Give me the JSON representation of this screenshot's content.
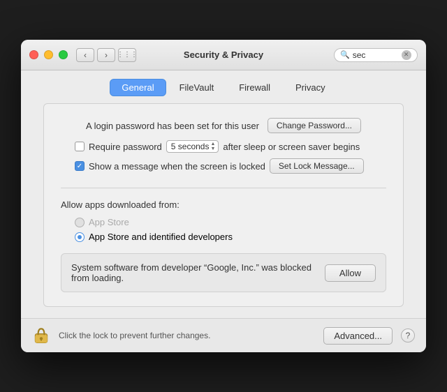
{
  "window": {
    "title": "Security & Privacy"
  },
  "titlebar": {
    "back_label": "‹",
    "forward_label": "›",
    "grid_label": "⋮⋮⋮"
  },
  "search": {
    "value": "sec",
    "placeholder": "Search"
  },
  "tabs": [
    {
      "id": "general",
      "label": "General",
      "active": true
    },
    {
      "id": "filevault",
      "label": "FileVault",
      "active": false
    },
    {
      "id": "firewall",
      "label": "Firewall",
      "active": false
    },
    {
      "id": "privacy",
      "label": "Privacy",
      "active": false
    }
  ],
  "general": {
    "password_label": "A login password has been set for this user",
    "change_password_btn": "Change Password...",
    "require_password_label": "Require password",
    "password_time": "5 seconds",
    "after_sleep_label": "after sleep or screen saver begins",
    "show_message_label": "Show a message when the screen is locked",
    "set_lock_message_btn": "Set Lock Message...",
    "allow_apps_title": "Allow apps downloaded from:",
    "radio_options": [
      {
        "id": "app-store",
        "label": "App Store",
        "selected": false
      },
      {
        "id": "app-store-identified",
        "label": "App Store and identified developers",
        "selected": true
      }
    ],
    "blocked_text": "System software from developer “Google, Inc.” was blocked from loading.",
    "allow_btn": "Allow",
    "footer_text": "Click the lock to prevent further changes.",
    "advanced_btn": "Advanced...",
    "help_label": "?"
  }
}
